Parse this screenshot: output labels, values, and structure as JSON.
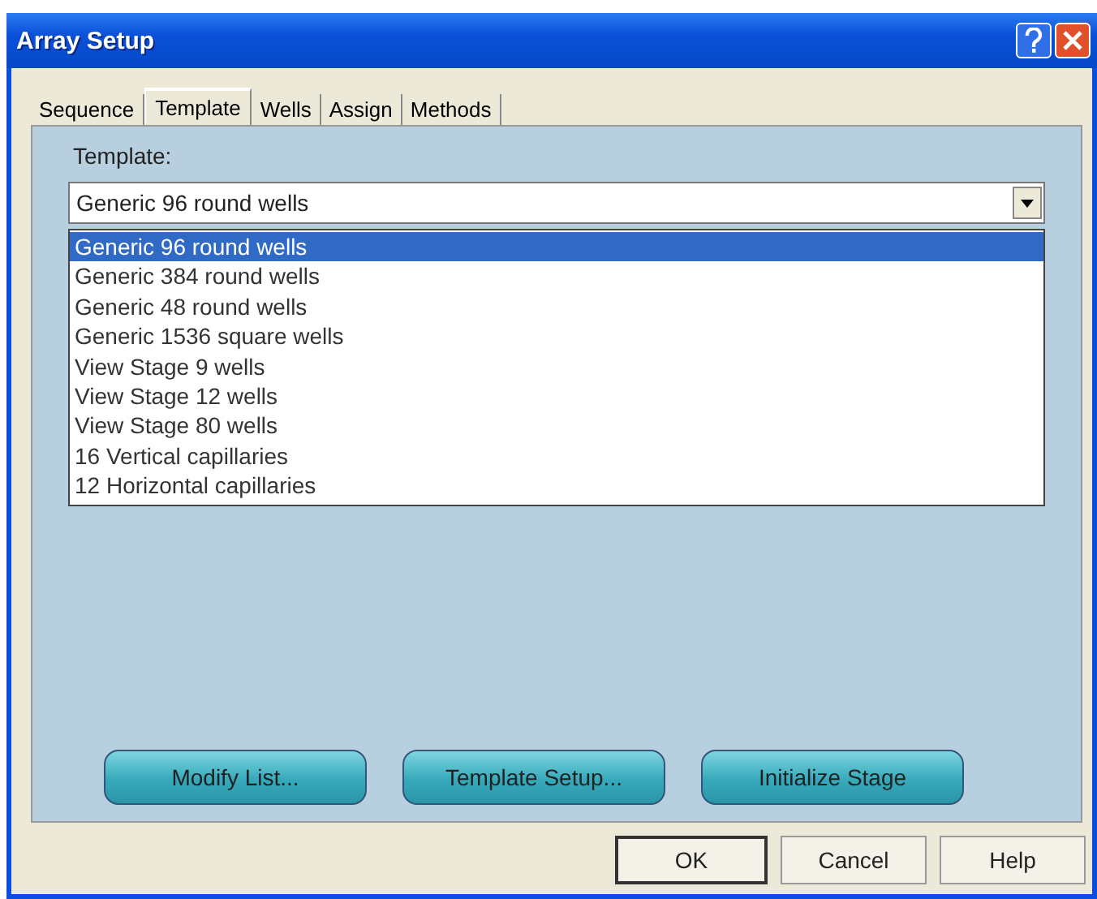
{
  "window": {
    "title": "Array Setup"
  },
  "tabs": [
    {
      "label": "Sequence",
      "selected": false
    },
    {
      "label": "Template",
      "selected": true
    },
    {
      "label": "Wells",
      "selected": false
    },
    {
      "label": "Assign",
      "selected": false
    },
    {
      "label": "Methods",
      "selected": false
    }
  ],
  "template": {
    "label": "Template:",
    "value": "Generic 96 round wells",
    "expanded": true,
    "options": [
      {
        "label": "Generic 96 round wells",
        "selected": true
      },
      {
        "label": "Generic 384 round wells",
        "selected": false
      },
      {
        "label": "Generic 48 round wells",
        "selected": false
      },
      {
        "label": "Generic 1536 square wells",
        "selected": false
      },
      {
        "label": "View Stage 9 wells",
        "selected": false
      },
      {
        "label": "View Stage 12 wells",
        "selected": false
      },
      {
        "label": "View Stage 80 wells",
        "selected": false
      },
      {
        "label": "16 Vertical capillaries",
        "selected": false
      },
      {
        "label": "12 Horizontal capillaries",
        "selected": false
      }
    ]
  },
  "panel_buttons": [
    "Modify List...",
    "Template Setup...",
    "Initialize Stage"
  ],
  "dialog_buttons": [
    {
      "label": "OK",
      "default": true
    },
    {
      "label": "Cancel",
      "default": false
    },
    {
      "label": "Help",
      "default": false
    }
  ]
}
